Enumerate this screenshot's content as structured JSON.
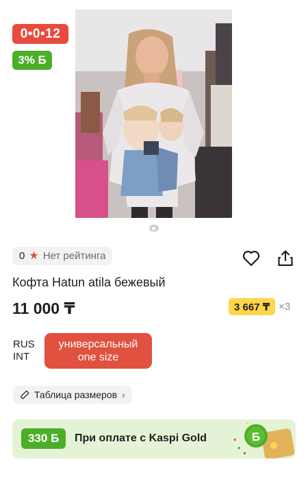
{
  "badges": {
    "installment": "0•0•12",
    "bonus": "3% Б"
  },
  "rating": {
    "count": "0",
    "label": "Нет рейтинга"
  },
  "product": {
    "title": "Кофта Hatun atila бежевый",
    "price": "11 000 ₸"
  },
  "installment": {
    "amount": "3 667 ₸",
    "times": "×3"
  },
  "size": {
    "label_line1": "RUS",
    "label_line2": "INT",
    "option_line1": "универсальный",
    "option_line2": "one size"
  },
  "size_table": {
    "label": "Таблица размеров"
  },
  "kaspi": {
    "bonus": "330 Б",
    "text": "При оплате с Kaspi Gold"
  },
  "colors": {
    "red": "#e84b3c",
    "green": "#4caf2a",
    "yellow": "#ffd54a",
    "banner_bg": "#e4f3d5"
  }
}
